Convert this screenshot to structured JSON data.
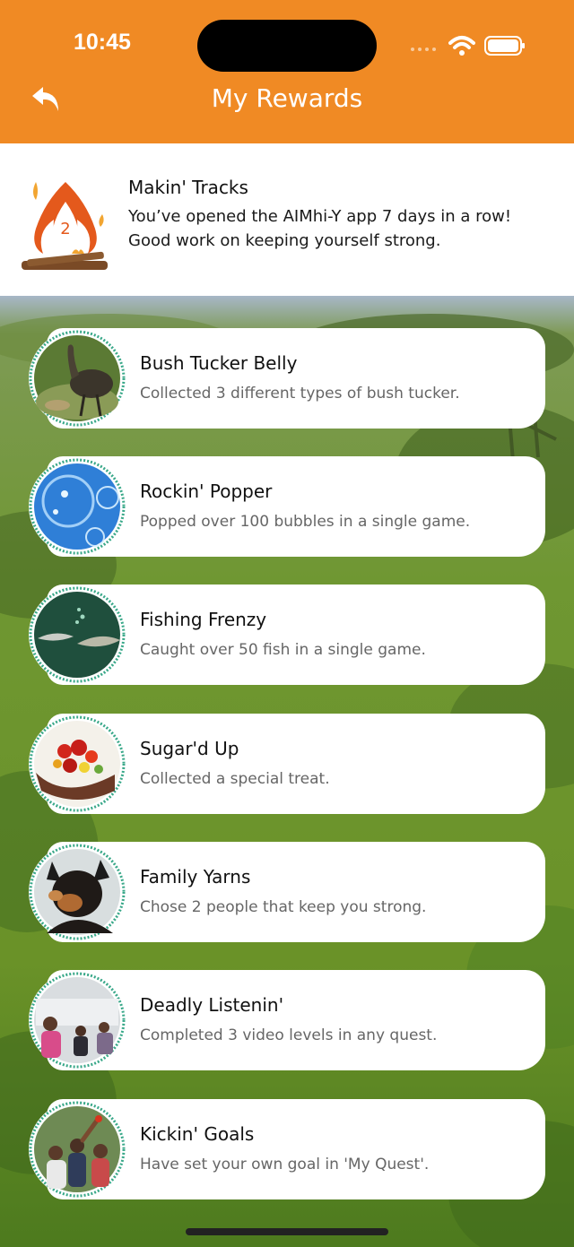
{
  "status_bar": {
    "time": "10:45"
  },
  "header": {
    "title": "My Rewards",
    "background_color": "#f08a24",
    "back_icon": "reply-arrow-icon"
  },
  "featured_reward": {
    "icon": "campfire-icon",
    "icon_number": "2",
    "title": "Makin' Tracks",
    "description": "You’ve opened the AIMhi-Y app 7 days in a row! Good work on keeping yourself strong."
  },
  "rewards": [
    {
      "title": "Bush Tucker Belly",
      "description": "Collected 3 different types of bush tucker.",
      "image": "emu-image"
    },
    {
      "title": "Rockin' Popper",
      "description": "Popped over 100 bubbles in a single game.",
      "image": "bubbles-image"
    },
    {
      "title": "Fishing Frenzy",
      "description": "Caught over 50 fish in a single game.",
      "image": "fish-image"
    },
    {
      "title": "Sugar'd Up",
      "description": "Collected a special treat.",
      "image": "berries-image"
    },
    {
      "title": "Family Yarns",
      "description": "Chose 2 people that keep you strong.",
      "image": "dog-image"
    },
    {
      "title": "Deadly Listenin'",
      "description": "Completed 3 video levels in any quest.",
      "image": "people-image"
    },
    {
      "title": "Kickin' Goals",
      "description": "Have set your own goal in 'My Quest'.",
      "image": "crowd-image"
    }
  ]
}
